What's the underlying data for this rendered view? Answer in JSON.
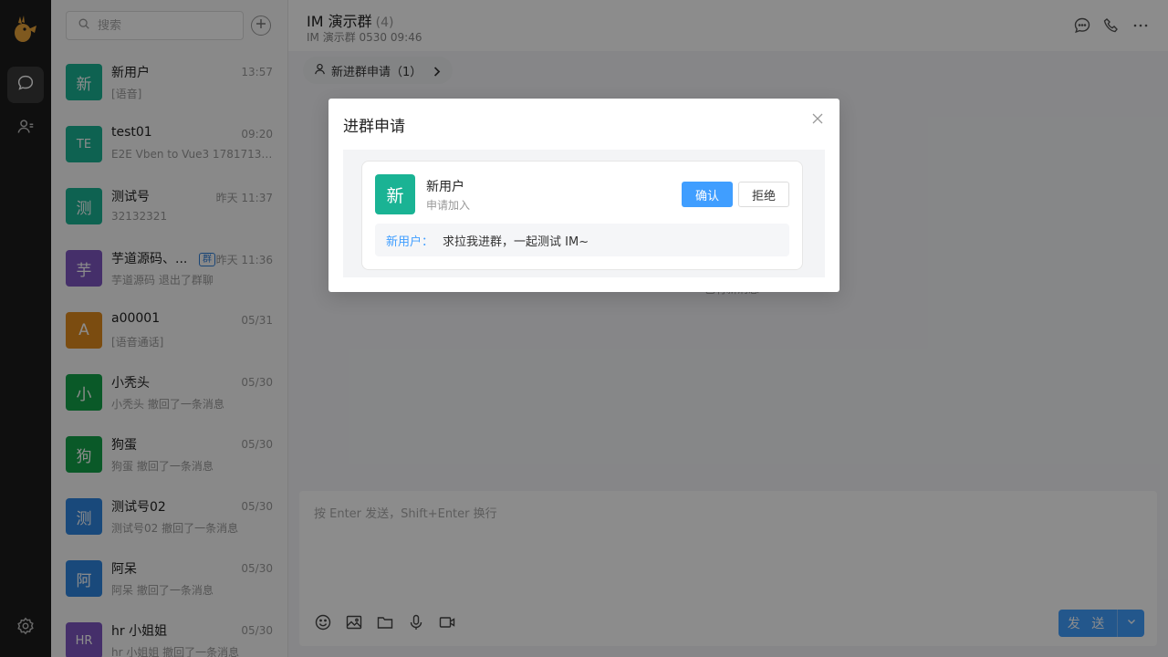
{
  "colors": {
    "accent": "#409eff",
    "rail": "#1d1d1d",
    "avatar_teal": "#1ab394",
    "avatar_purple": "#7e57c2",
    "avatar_orange": "#e08a1e",
    "avatar_green": "#13a34a",
    "avatar_blue": "#2f86e0"
  },
  "rail": {
    "icons": [
      "logo-icon",
      "chat-icon",
      "contacts-icon",
      "settings-icon"
    ]
  },
  "search": {
    "placeholder": "搜索",
    "value": ""
  },
  "conversations": [
    {
      "avatar": "新",
      "color": "#1ab394",
      "name": "新用户",
      "time": "13:57",
      "preview": "[语音]",
      "tag": ""
    },
    {
      "avatar": "TE",
      "color": "#1ab394",
      "name": "test01",
      "time": "09:20",
      "preview": "E2E Vben to Vue3 178171316...",
      "tag": ""
    },
    {
      "avatar": "测",
      "color": "#1ab394",
      "name": "测试号",
      "time": "昨天 11:37",
      "preview": "32132321",
      "tag": ""
    },
    {
      "avatar": "芋",
      "color": "#7e57c2",
      "name": "芋道源码、...",
      "time": "昨天 11:36",
      "preview": "芋道源码 退出了群聊",
      "tag": "群"
    },
    {
      "avatar": "A",
      "color": "#e08a1e",
      "name": "a00001",
      "time": "05/31",
      "preview": "[语音通话]",
      "tag": ""
    },
    {
      "avatar": "小",
      "color": "#13a34a",
      "name": "小秃头",
      "time": "05/30",
      "preview": "小秃头 撤回了一条消息",
      "tag": ""
    },
    {
      "avatar": "狗",
      "color": "#13a34a",
      "name": "狗蛋",
      "time": "05/30",
      "preview": "狗蛋 撤回了一条消息",
      "tag": ""
    },
    {
      "avatar": "测",
      "color": "#2f86e0",
      "name": "测试号02",
      "time": "05/30",
      "preview": "测试号02 撤回了一条消息",
      "tag": ""
    },
    {
      "avatar": "阿",
      "color": "#2f86e0",
      "name": "阿呆",
      "time": "05/30",
      "preview": "阿呆 撤回了一条消息",
      "tag": ""
    },
    {
      "avatar": "HR",
      "color": "#7e57c2",
      "name": "hr 小姐姐",
      "time": "05/30",
      "preview": "hr 小姐姐 撤回了一条消息",
      "tag": ""
    }
  ],
  "chat": {
    "title": "IM 演示群",
    "member_count": "(4)",
    "subtitle": "IM 演示群 0530 09:46",
    "join_pill": "新进群申请（1）",
    "behind_text": "已有新消息",
    "composer_placeholder": "按 Enter 发送，Shift+Enter 换行",
    "send_label": "发 送",
    "header_icons": [
      "message-icon",
      "phone-icon",
      "more-icon"
    ],
    "tool_icons": [
      "emoji-icon",
      "image-icon",
      "folder-icon",
      "mic-icon",
      "video-icon"
    ]
  },
  "modal": {
    "title": "进群申请",
    "request": {
      "avatar": "新",
      "name": "新用户",
      "sub": "申请加入",
      "confirm": "确认",
      "reject": "拒绝",
      "message_sender": "新用户：",
      "message_text": "求拉我进群，一起测试 IM~"
    }
  }
}
